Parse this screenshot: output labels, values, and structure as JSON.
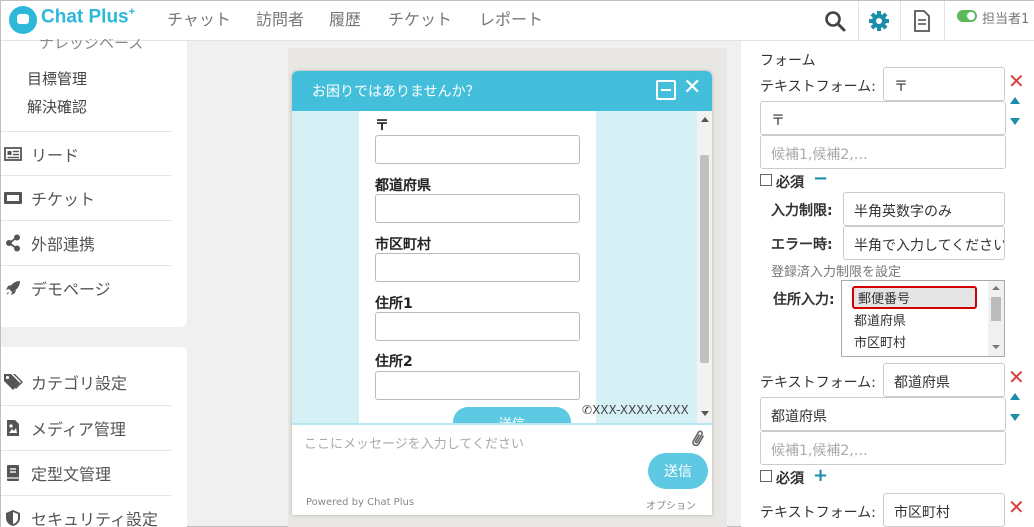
{
  "app": {
    "logo_text": "Chat Plus",
    "logo_sup": "+",
    "nav": [
      "チャット",
      "訪問者",
      "履歴",
      "チケット",
      "レポート"
    ],
    "agent_label": "担当者1"
  },
  "sidebar": {
    "partial_top": "ナレッジベース",
    "sub_items": [
      "目標管理",
      "解決確認"
    ],
    "items1": [
      {
        "label": "リード",
        "icon": "lead-card-icon"
      },
      {
        "label": "チケット",
        "icon": "ticket-icon"
      },
      {
        "label": "外部連携",
        "icon": "share-icon"
      },
      {
        "label": "デモページ",
        "icon": "rocket-icon"
      }
    ],
    "items2": [
      {
        "label": "カテゴリ設定",
        "icon": "tags-icon"
      },
      {
        "label": "メディア管理",
        "icon": "media-file-icon"
      },
      {
        "label": "定型文管理",
        "icon": "template-book-icon"
      },
      {
        "label": "セキュリティ設定",
        "icon": "shield-icon"
      }
    ]
  },
  "chat_widget": {
    "title": "お困りではありませんか？",
    "fields": [
      "〒",
      "都道府県",
      "市区町村",
      "住所1",
      "住所2"
    ],
    "send_partial": "送信",
    "phone": "XXX-XXXX-XXXX",
    "input_placeholder": "ここにメッセージを入力してください",
    "send_label": "送信",
    "powered_by": "Powered by Chat Plus",
    "option_label": "オプション"
  },
  "form_settings": {
    "section_title": "フォーム",
    "text_form_label": "テキストフォーム:",
    "candidates_placeholder": "候補1,候補2,…",
    "required_label": "必須",
    "input_limit_label": "入力制限:",
    "error_label": "エラー時:",
    "registered_limit_label": "登録済入力制限を設定",
    "address_input_label": "住所入力:",
    "entries": [
      {
        "name": "〒",
        "value": "〒",
        "input_limit": "半角英数字のみ",
        "error_text": "半角で入力してください"
      },
      {
        "name": "都道府県",
        "value": "都道府県"
      },
      {
        "name": "市区町村"
      }
    ],
    "address_options": [
      "郵便番号",
      "都道府県",
      "市区町村"
    ],
    "address_selected": "郵便番号"
  },
  "colors": {
    "brand": "#2bb8d9",
    "widget_header": "#43bfdc",
    "delete_red": "#d9403a",
    "highlight_red": "#d40000"
  }
}
